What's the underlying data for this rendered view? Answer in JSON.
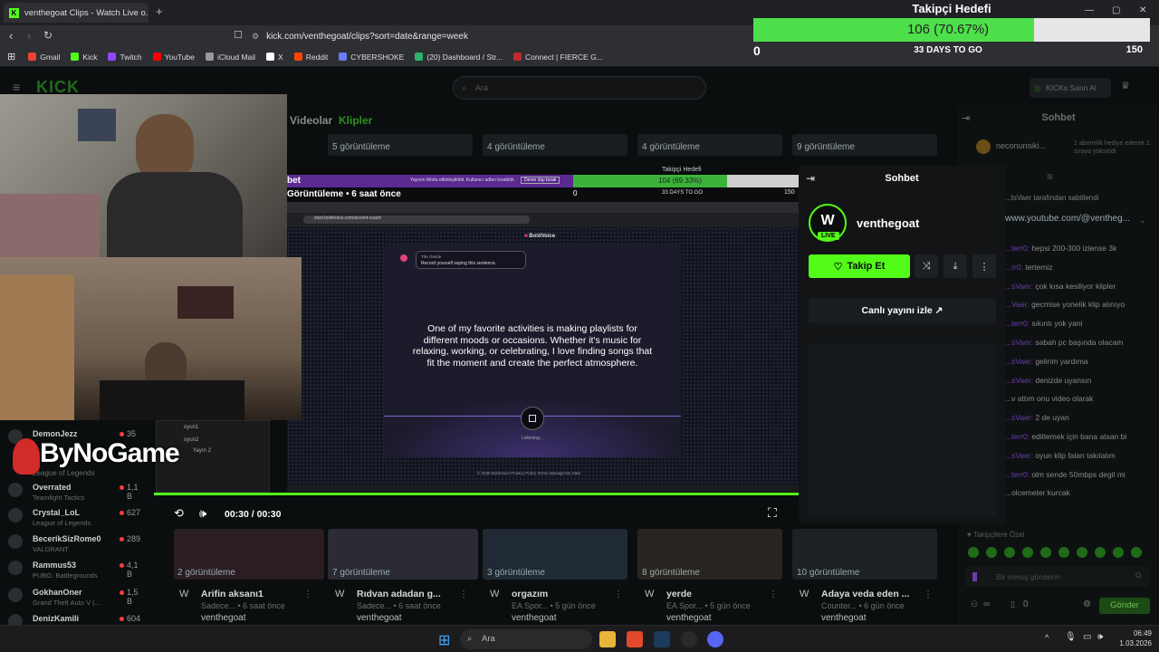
{
  "browser": {
    "tab_title": "venthegoat Clips - Watch Live o...",
    "tab_close": "✕",
    "new_tab": "+",
    "url": "kick.com/venthegoat/clips?sort=date&range=week",
    "window_controls": [
      "—",
      "▢",
      "✕"
    ],
    "bookmarks": [
      {
        "label": "Gmail",
        "color": "#ea4335"
      },
      {
        "label": "Kick",
        "color": "#53fc18"
      },
      {
        "label": "Twitch",
        "color": "#9146ff"
      },
      {
        "label": "YouTube",
        "color": "#ff0000"
      },
      {
        "label": "iCloud Mail",
        "color": "#9a9a9a"
      },
      {
        "label": "X",
        "color": "#ffffff"
      },
      {
        "label": "Reddit",
        "color": "#ff4500"
      },
      {
        "label": "CYBERSHOKE",
        "color": "#6b7cff"
      },
      {
        "label": "(20) Dashboard / Str...",
        "color": "#2fb46b"
      },
      {
        "label": "Connect | FIERCE G...",
        "color": "#c02a2a"
      }
    ]
  },
  "goal": {
    "title": "Takipçi Hedefi",
    "progress_text": "106 (70.67%)",
    "progress_fraction": 0.7067,
    "min": "0",
    "max": "150",
    "days_left": "33 DAYS TO GO"
  },
  "kick": {
    "logo": "KICK",
    "search_placeholder": "Ara",
    "kicks_button": "KICKs Satın Al",
    "tabs": [
      "Videolar",
      "Klipler"
    ],
    "sohbet_bg_title": "Sohbet",
    "top_views": [
      "5 görüntüleme",
      "4 görüntüleme",
      "4 görüntüleme",
      "9 görüntüleme"
    ],
    "bottom_views": [
      "2 görüntüleme",
      "7 görüntüleme",
      "3 görüntüleme",
      "8 görüntüleme",
      "10 görüntüleme"
    ],
    "clips": [
      {
        "title": "Arifin aksanı1",
        "sub": "Sadece... • 6 saat önce",
        "channel": "venthegoat"
      },
      {
        "title": "Rıdvan adadan g...",
        "sub": "Sadece... • 6 saat önce",
        "channel": "venthegoat"
      },
      {
        "title": "orgazım",
        "sub": "EA Spor... • 5 gün önce",
        "channel": "venthegoat"
      },
      {
        "title": "yerde",
        "sub": "EA Spor... • 5 gün önce",
        "channel": "venthegoat"
      },
      {
        "title": "Adaya veda eden ...",
        "sub": "Counter... • 6 gün önce",
        "channel": "venthegoat"
      }
    ],
    "sidebar_channels": [
      {
        "name": "DemonJezz",
        "game": "",
        "count": "35"
      },
      {
        "name": "Overrated",
        "game": "Teamfight Tactics",
        "count": "1,1 B"
      },
      {
        "name": "Crystal_LoL",
        "game": "League of Legends",
        "count": "627"
      },
      {
        "name": "BecerikSizRome0",
        "game": "VALORANT",
        "count": "289"
      },
      {
        "name": "Rammus53",
        "game": "PUBG: Battlegrounds",
        "count": "4,1 B"
      },
      {
        "name": "GokhanOner",
        "game": "Grand Theft Auto V (...",
        "count": "1,5 B"
      },
      {
        "name": "DenizKamili",
        "game": "",
        "count": "604"
      }
    ],
    "side_game": "League of Legends",
    "chat_notice": "1 abonelik hediye ederek 2. sıraya yükseldi",
    "chat_notice_user": "neconunsiki...",
    "chat_pinned": "...tsVaer tarafından sabitlendi",
    "chat_pinned_link": "www.youtube.com/@ventheg...",
    "chat_lines": [
      {
        "user": "...terr0:",
        "text": "hepsi 200-300 izlense 3k"
      },
      {
        "user": "...rr0:",
        "text": "tertemiz"
      },
      {
        "user": "...sVaer:",
        "text": "çok kısa kesiliyor klipler"
      },
      {
        "user": "...Vaer:",
        "text": "gecmise yonelik klip alınıyo"
      },
      {
        "user": "...terr0:",
        "text": "sıkıntı yok yani"
      },
      {
        "user": "...sVaer:",
        "text": "sabah pc başında olacam"
      },
      {
        "user": "...sVaer:",
        "text": "gelirim yardıma"
      },
      {
        "user": "...sVaer:",
        "text": "denizde uyansın"
      },
      {
        "user": "",
        "text": "...v attım onu video olarak"
      },
      {
        "user": "...sVaer:",
        "text": "2 de uyan"
      },
      {
        "user": "...terr0:",
        "text": "editlemek için bana atsan bi"
      },
      {
        "user": "...sVaer:",
        "text": "oyun klip falan takılalım"
      },
      {
        "user": "...terr0:",
        "text": "olm sende 50mbps degil mi"
      },
      {
        "user": "",
        "text": "...olcemeter kurcak"
      }
    ],
    "chat_input_placeholder": "Bir mesaj gönderin",
    "send_button": "Gönder",
    "supporters_label": "Takipçilere Özel",
    "chat_counts": [
      "∞",
      "0"
    ]
  },
  "player": {
    "title_strip_left": "bet",
    "title_strip_sub": "Görüntüleme • 6 saat önce",
    "inner_goal_title": "Takipçi Hedefi",
    "inner_goal_progress": "104 (69.33%)",
    "inner_goal_fraction": 0.6933,
    "inner_goal_min": "0",
    "inner_goal_max": "150",
    "inner_goal_days": "33 DAYS TO GO",
    "inner_notice": "Yayının Modu etkinleştirildi. Kullanıcı adları kısaltıldı.",
    "inner_notice_btn": "Devre dışı bırak",
    "inner_url": "start.boldvoice.com/accent-coach",
    "bv_brand": "BoldVoice",
    "bv_card_title": "The Oracle",
    "bv_card_text": "Record yourself saying this sentence.",
    "bv_sentence": "One of my favorite activities is making playlists for different moods or occasions. Whether it's music for relaxing, working, or celebrating, I love finding songs that fit the moment and create the perfect atmosphere.",
    "bv_status": "Listening...",
    "bv_footer": "© 2026 BoldVoice   Privacy Policy   Terms   Manage My Data",
    "time": "00:30 / 00:30",
    "progress_fraction": 1.0
  },
  "sohbet": {
    "title": "Sohbet",
    "channel": "venthegoat",
    "live_badge": "LIVE",
    "follow_btn": "Takip Et",
    "watch_live": "Canlı yayını izle"
  },
  "overlay": {
    "watermark": "ByNoGame",
    "obs_items": [
      "oyun1",
      "oyun2",
      "Yayın 2"
    ]
  },
  "taskbar": {
    "search": "Ara",
    "time": "06:49",
    "date": "1.03.2026"
  }
}
